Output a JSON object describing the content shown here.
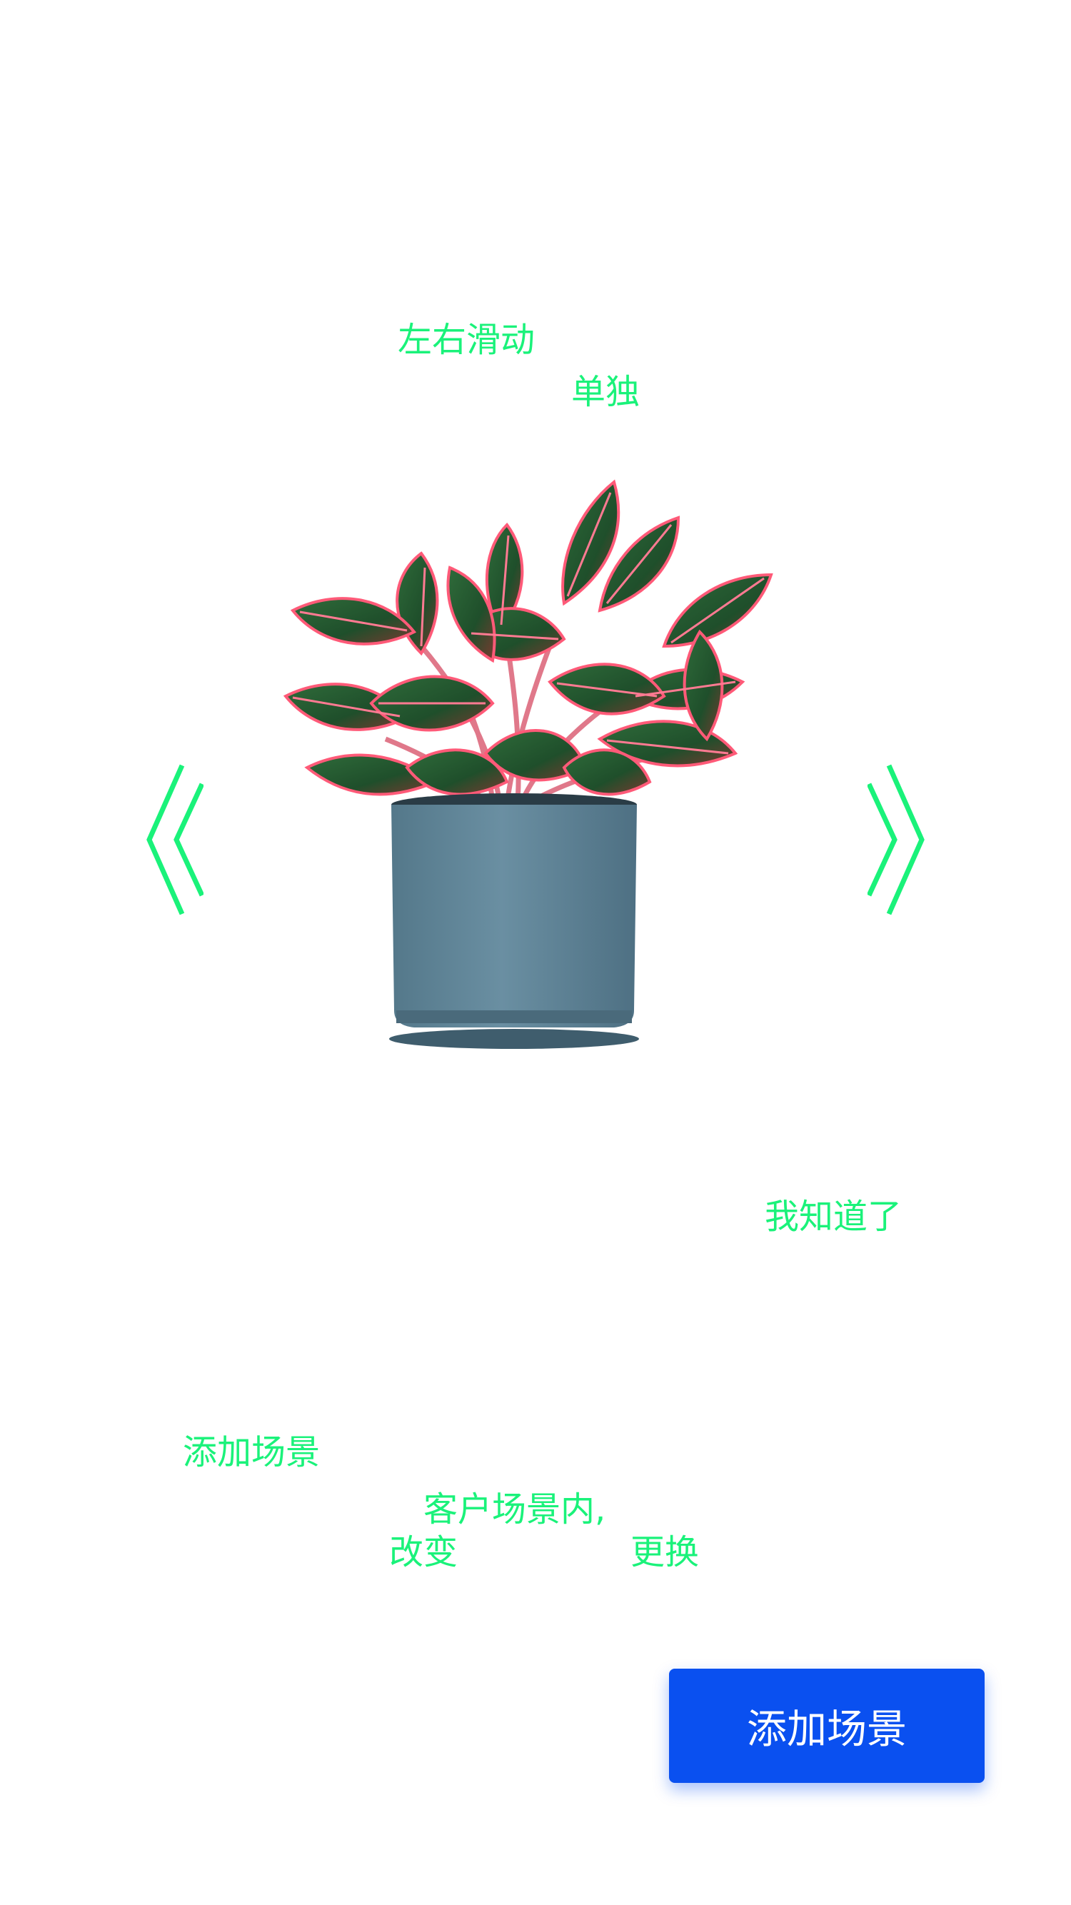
{
  "guide": {
    "swipe_hint_line1": "左右滑动",
    "swipe_hint_line2": "单独",
    "got_it": "我知道了",
    "add_scene_hint": "添加场景",
    "scene_hint_line1": "客户场景内,",
    "scene_hint_change": "改变",
    "scene_hint_replace": "更换"
  },
  "icons": {
    "prev": "double-chevron-left-icon",
    "next": "double-chevron-right-icon"
  },
  "actions": {
    "add_scene_button": "添加场景"
  },
  "colors": {
    "hint_green": "#1af27a",
    "primary_blue": "#0a50f0",
    "background": "#ffffff"
  }
}
